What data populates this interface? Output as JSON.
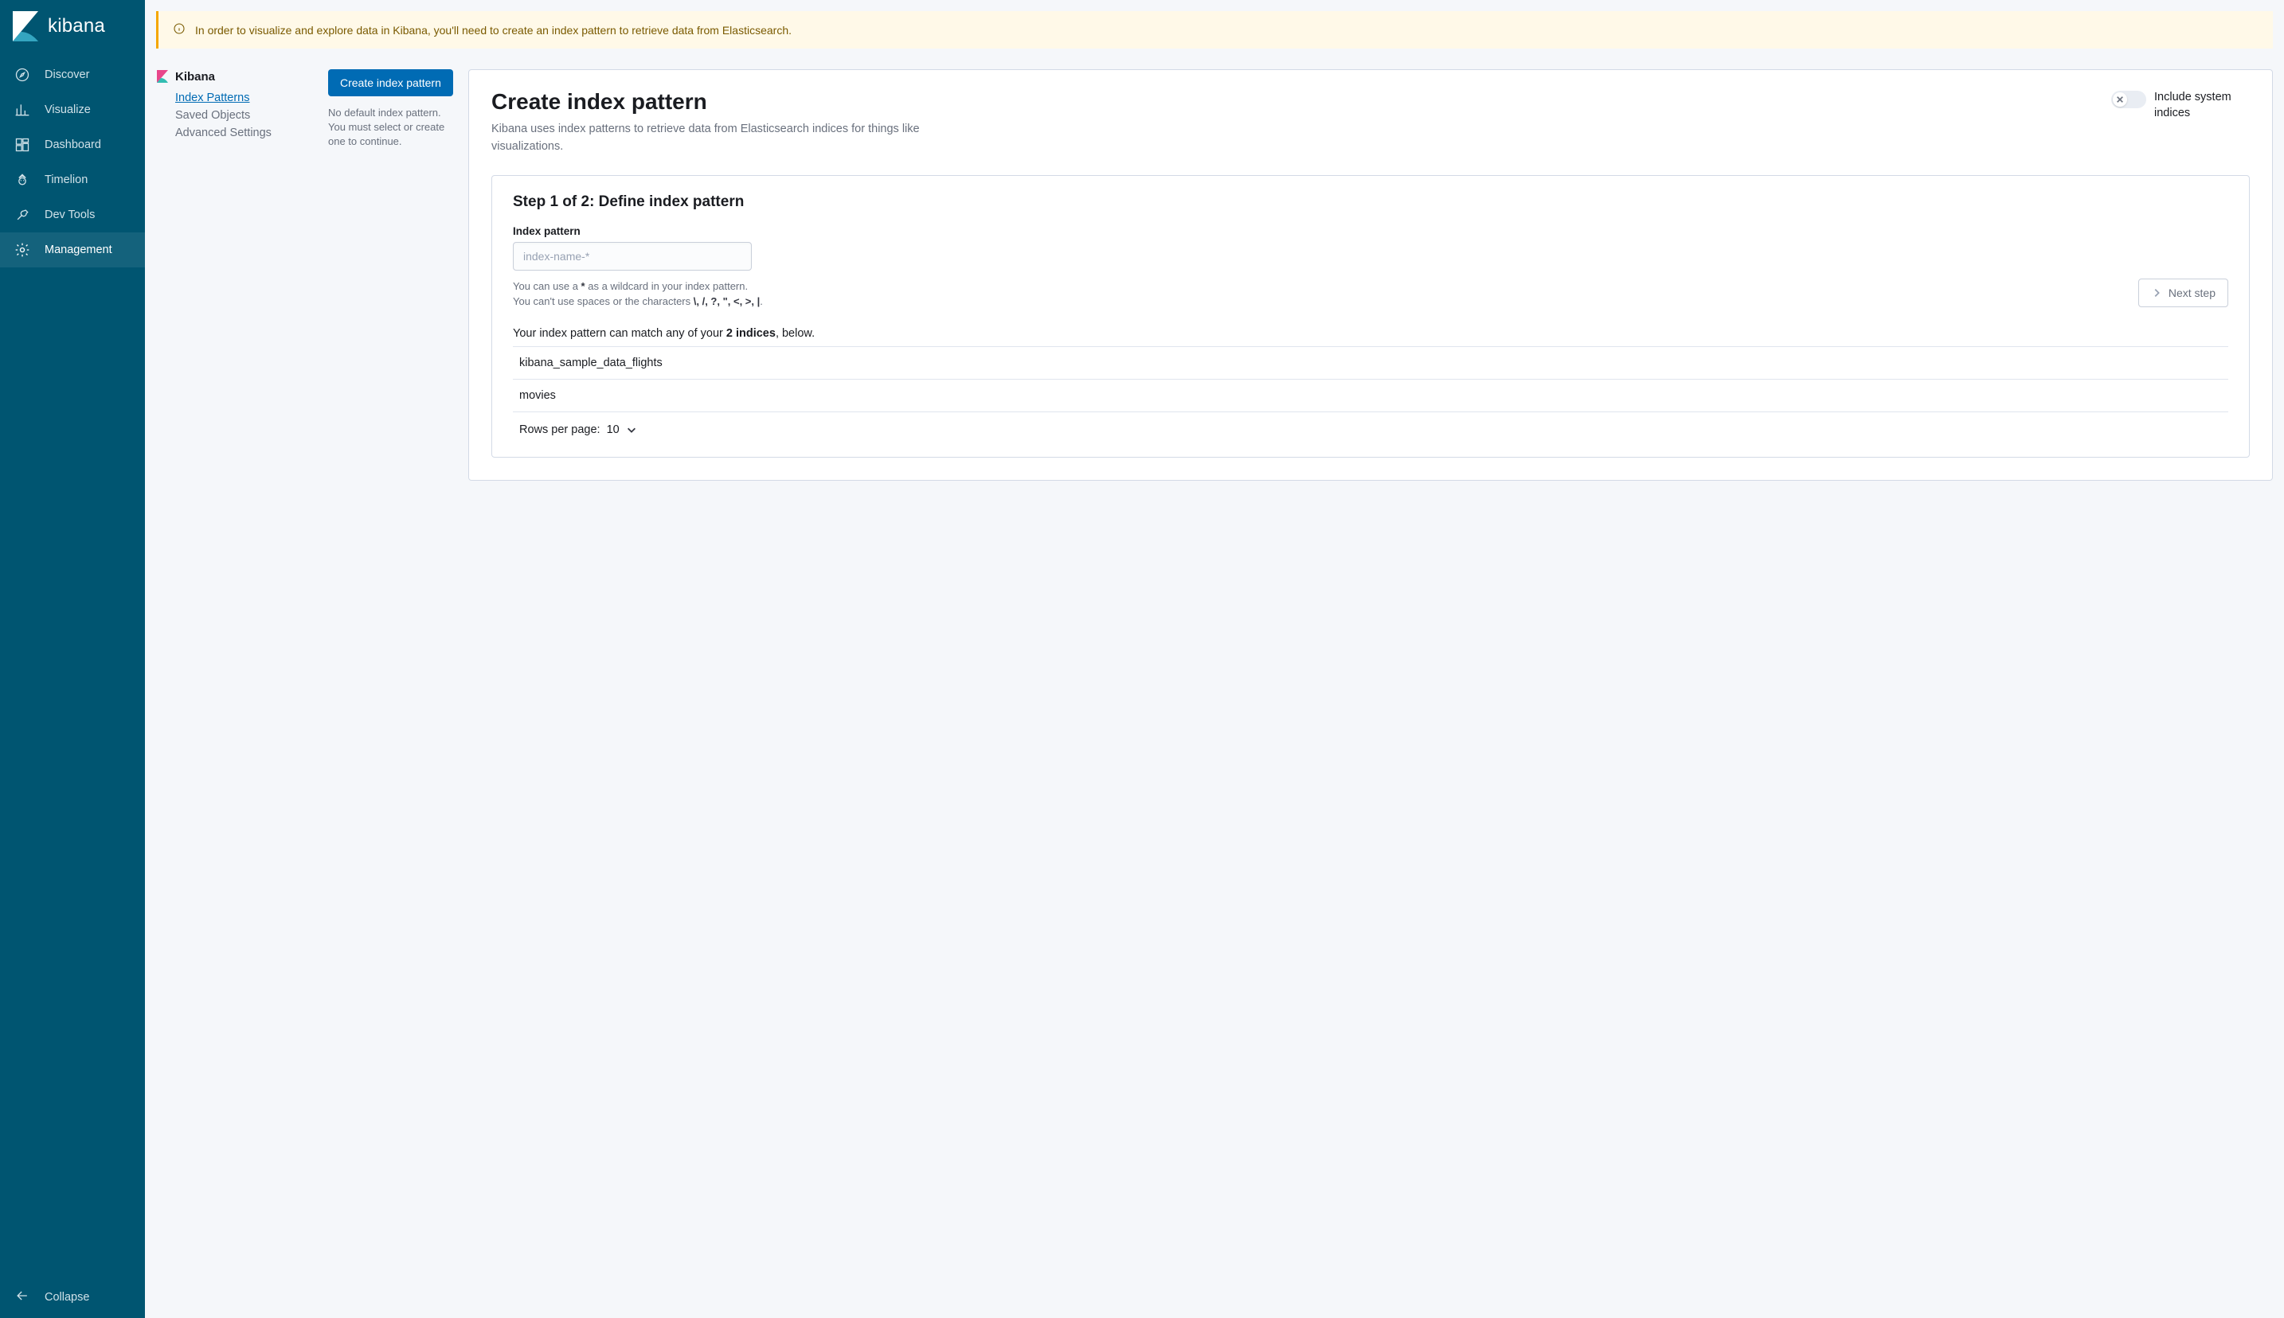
{
  "brand": "kibana",
  "colors": {
    "sidebar_bg": "#005571",
    "primary": "#006bb4",
    "warn_bg": "#fff9e8",
    "warn_border": "#f5a700"
  },
  "sidebar": {
    "items": [
      {
        "id": "discover",
        "label": "Discover"
      },
      {
        "id": "visualize",
        "label": "Visualize"
      },
      {
        "id": "dashboard",
        "label": "Dashboard"
      },
      {
        "id": "timelion",
        "label": "Timelion"
      },
      {
        "id": "devtools",
        "label": "Dev Tools"
      },
      {
        "id": "management",
        "label": "Management"
      }
    ],
    "active_id": "management",
    "collapse_label": "Collapse"
  },
  "callout": {
    "text": "In order to visualize and explore data in Kibana, you'll need to create an index pattern to retrieve data from Elasticsearch."
  },
  "mgmt": {
    "section_title": "Kibana",
    "links": [
      {
        "id": "index-patterns",
        "label": "Index Patterns",
        "active": true
      },
      {
        "id": "saved-objects",
        "label": "Saved Objects",
        "active": false
      },
      {
        "id": "advanced-settings",
        "label": "Advanced Settings",
        "active": false
      }
    ],
    "create_button": "Create index pattern",
    "helper": "No default index pattern. You must select or create one to continue."
  },
  "card": {
    "title": "Create index pattern",
    "desc": "Kibana uses index patterns to retrieve data from Elasticsearch indices for things like visualizations.",
    "toggle_label": "Include system indices",
    "toggle_on": false
  },
  "step": {
    "title": "Step 1 of 2: Define index pattern",
    "field_label": "Index pattern",
    "placeholder": "index-name-*",
    "value": "",
    "hint1_pre": "You can use a ",
    "hint1_bold": "*",
    "hint1_post": " as a wildcard in your index pattern.",
    "hint2_pre": "You can't use spaces or the characters ",
    "hint2_bold": "\\, /, ?, \", <, >, |",
    "hint2_post": ".",
    "next_label": "Next step",
    "match_pre": "Your index pattern can match any of your ",
    "match_bold": "2 indices",
    "match_post": ", below.",
    "indices": [
      "kibana_sample_data_flights",
      "movies"
    ],
    "rows_per_page_label": "Rows per page: ",
    "rows_per_page_value": "10"
  }
}
